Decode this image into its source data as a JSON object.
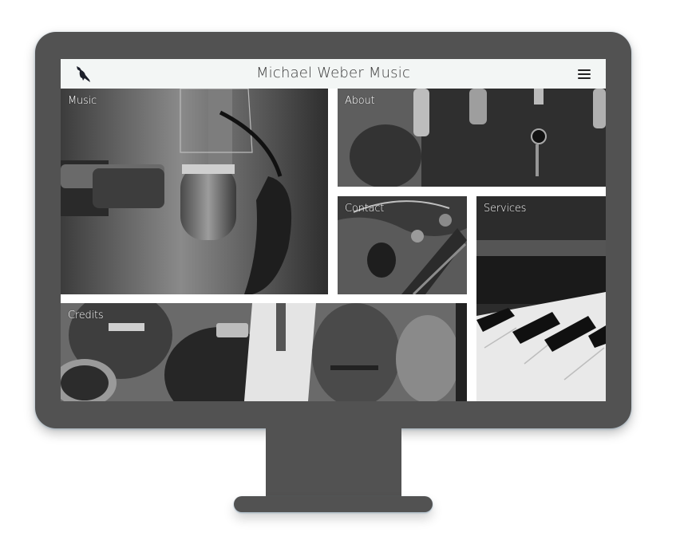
{
  "header": {
    "title": "Michael Weber Music",
    "logo_icon": "bird-icon",
    "menu_icon": "hamburger-menu-icon"
  },
  "tiles": {
    "music": {
      "label": "Music"
    },
    "about": {
      "label": "About"
    },
    "contact": {
      "label": "Contact"
    },
    "services": {
      "label": "Services"
    },
    "credits": {
      "label": "Credits"
    }
  },
  "colors": {
    "monitor": "#525252",
    "header_bg": "#f3f6f5",
    "title_text": "#3a3a3a",
    "label_text": "#ffffff"
  }
}
